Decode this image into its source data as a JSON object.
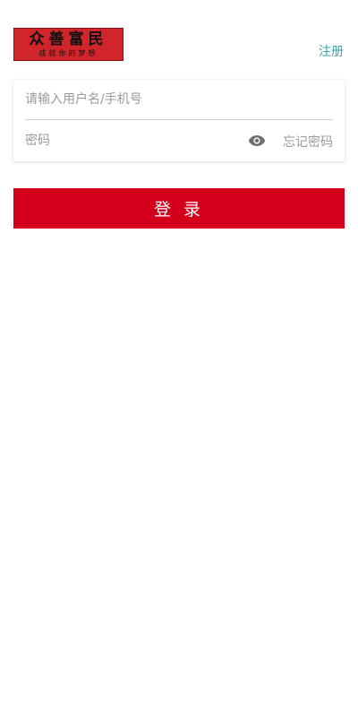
{
  "logo": {
    "title": "众善富民",
    "subtitle": "成就你的梦想"
  },
  "header": {
    "register_label": "注册"
  },
  "form": {
    "username_placeholder": "请输入用户名/手机号",
    "username_value": "",
    "password_placeholder": "密码",
    "password_value": "",
    "show_password_icon": "eye-icon",
    "forgot_label": "忘记密码"
  },
  "login_button_label": "登 录",
  "colors": {
    "primary_red": "#d4001b",
    "logo_red": "#d0262b",
    "link_teal": "#3aa3b3",
    "placeholder_gray": "#9a9a9a"
  }
}
